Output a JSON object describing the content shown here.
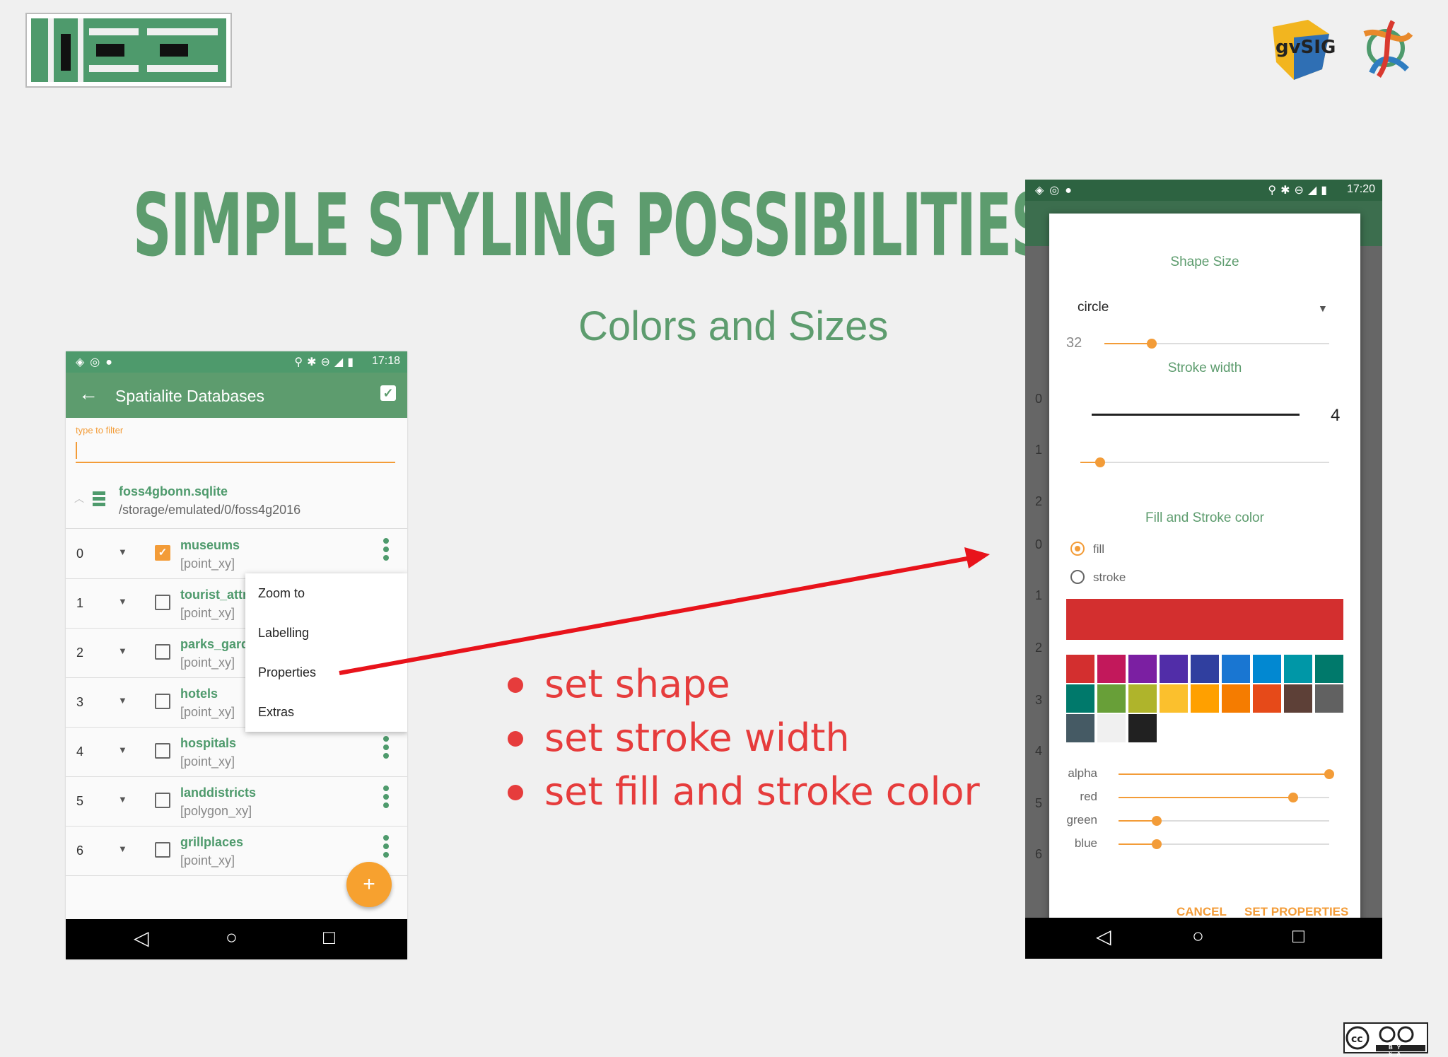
{
  "slide": {
    "title": "SIMPLE STYLING POSSIBILITIES",
    "subtitle": "Colors and Sizes",
    "bullets": [
      "set shape",
      "set stroke width",
      "set fill and stroke color"
    ]
  },
  "logos": {
    "left": "hce-logo",
    "right1": "gvsig-logo",
    "right1_text": "gvSIG",
    "right2": "osgeo-logo",
    "license": "cc-by-sa-badge",
    "license_text": "BY SA"
  },
  "phone1": {
    "status_time": "17:18",
    "appbar_title": "Spatialite Databases",
    "filter_hint": "type to filter",
    "db_name": "foss4gbonn.sqlite",
    "db_path": "/storage/emulated/0/foss4g2016",
    "rows": [
      {
        "index": "0",
        "name": "museums",
        "type": "[point_xy]",
        "checked": true
      },
      {
        "index": "1",
        "name": "tourist_attr",
        "type": "[point_xy]",
        "checked": false
      },
      {
        "index": "2",
        "name": "parks_gard",
        "type": "[point_xy]",
        "checked": false
      },
      {
        "index": "3",
        "name": "hotels",
        "type": "[point_xy]",
        "checked": false
      },
      {
        "index": "4",
        "name": "hospitals",
        "type": "[point_xy]",
        "checked": false
      },
      {
        "index": "5",
        "name": "landdistricts",
        "type": "[polygon_xy]",
        "checked": false
      },
      {
        "index": "6",
        "name": "grillplaces",
        "type": "[point_xy]",
        "checked": false
      }
    ],
    "menu": [
      "Zoom to",
      "Labelling",
      "Properties",
      "Extras"
    ],
    "fab_label": "+"
  },
  "phone2": {
    "status_time": "17:20",
    "background_indices": [
      "0",
      "1",
      "2",
      "0",
      "1",
      "2",
      "3",
      "4",
      "5",
      "6"
    ],
    "shape_size_label": "Shape Size",
    "shape_value": "circle",
    "shape_size_value": "32",
    "shape_size_fraction": 0.21,
    "stroke_width_label": "Stroke width",
    "stroke_width_value": "4",
    "stroke_width_fraction": 0.08,
    "fill_stroke_label": "Fill and Stroke color",
    "radio_fill": "fill",
    "radio_stroke": "stroke",
    "selected_radio": "fill",
    "preview_color": "#d32f2f",
    "swatches": [
      "#d32f2f",
      "#c2185b",
      "#7b1fa2",
      "#512da8",
      "#303f9f",
      "#1976d2",
      "#0288d1",
      "#0097a7",
      "#00796b",
      "#00796b",
      "#689f38",
      "#afb42b",
      "#fbc02d",
      "#ffa000",
      "#f57c00",
      "#e64a19",
      "#5d4037",
      "#616161",
      "#455a64",
      "#f0f0f0",
      "#212121"
    ],
    "rgb": [
      {
        "label": "alpha",
        "fraction": 1.0
      },
      {
        "label": "red",
        "fraction": 0.83
      },
      {
        "label": "green",
        "fraction": 0.18
      },
      {
        "label": "blue",
        "fraction": 0.18
      }
    ],
    "cancel_label": "CANCEL",
    "set_label": "SET PROPERTIES"
  },
  "colors": {
    "green": "#5d9c6e",
    "accent": "#f39c38",
    "bullet": "#e63c3c",
    "arrow": "#e8131b"
  }
}
